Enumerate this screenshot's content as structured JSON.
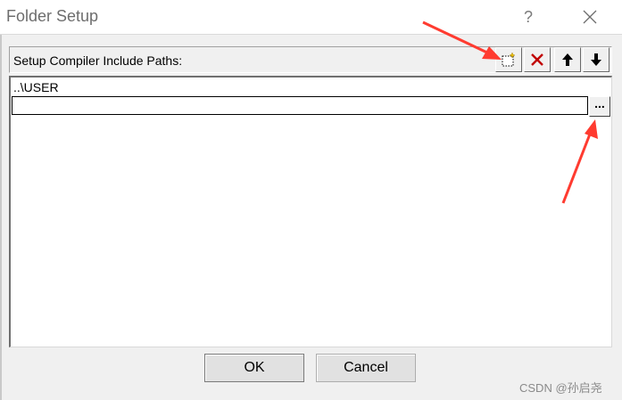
{
  "window": {
    "title": "Folder Setup",
    "help_glyph": "?"
  },
  "header": {
    "label": "Setup Compiler Include Paths:",
    "toolbar": {
      "new_icon": "new-folder-icon",
      "delete_icon": "delete-x-icon",
      "move_up_icon": "arrow-up-icon",
      "move_down_icon": "arrow-down-icon"
    }
  },
  "paths": [
    "..\\USER"
  ],
  "edit": {
    "value": "",
    "browse_label": "..."
  },
  "buttons": {
    "ok": "OK",
    "cancel": "Cancel"
  },
  "watermark": "CSDN @孙启尧",
  "colors": {
    "annotation_arrow": "#ff3b30",
    "delete_icon": "#c00000"
  }
}
